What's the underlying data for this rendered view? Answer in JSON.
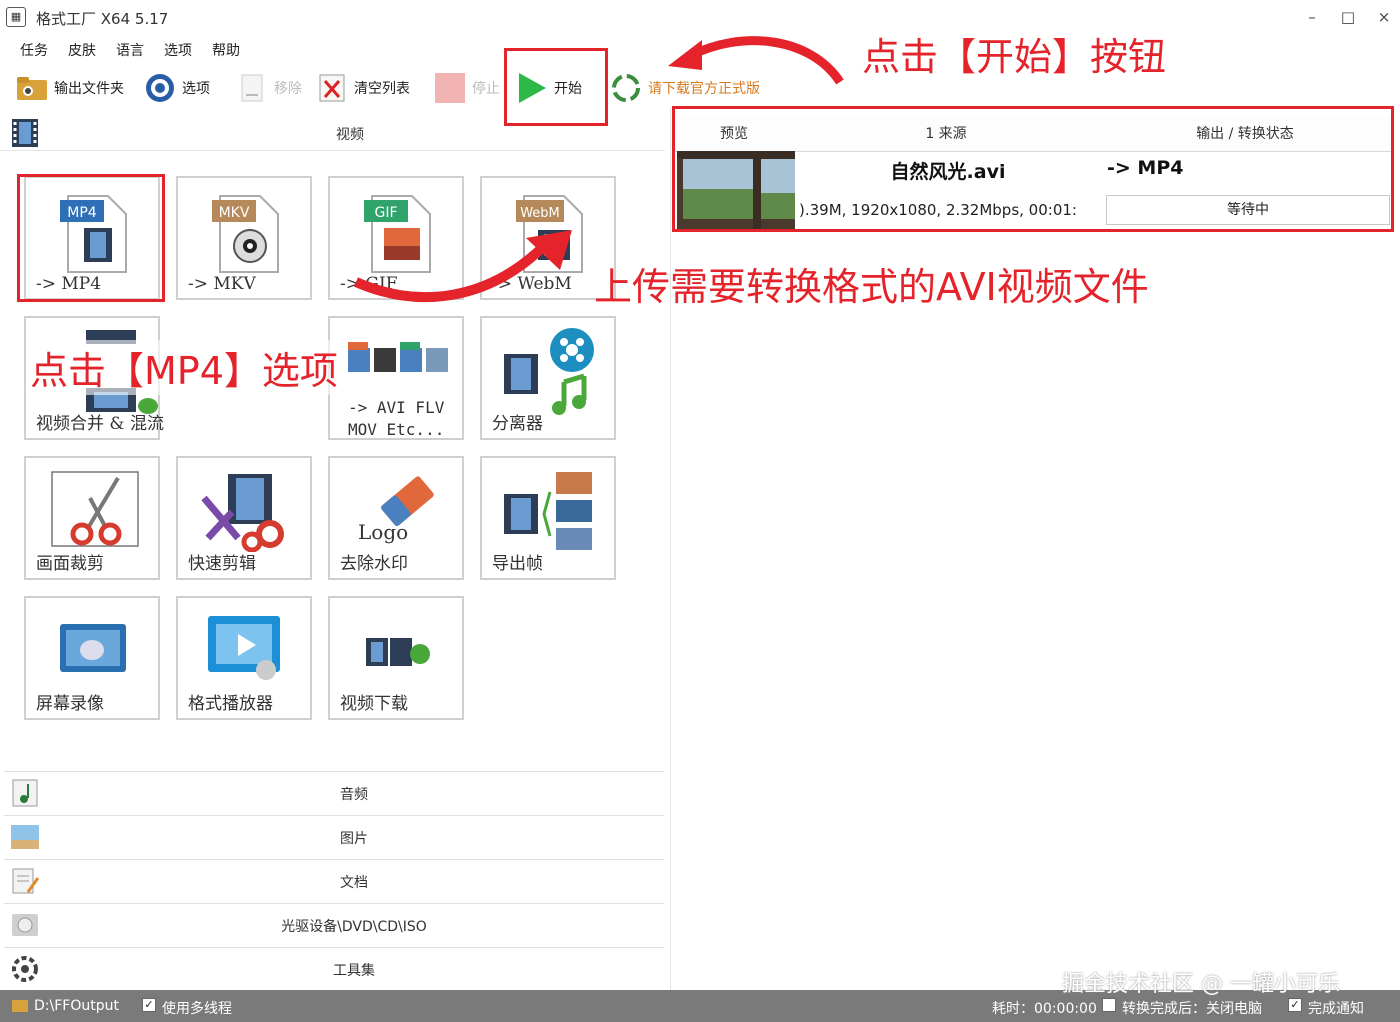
{
  "titlebar": {
    "title": "格式工厂 X64 5.17",
    "minimize": "–",
    "maximize": "□",
    "close": "×"
  },
  "menu": [
    "任务",
    "皮肤",
    "语言",
    "选项",
    "帮助"
  ],
  "toolbar": {
    "output_folder": "输出文件夹",
    "options": "选项",
    "remove": "移除",
    "clear_list": "清空列表",
    "stop": "停止",
    "start": "开始",
    "download_official": "请下载官方正式版"
  },
  "video_section": {
    "title": "视频"
  },
  "tiles": [
    {
      "id": "mp4",
      "badge": "MP4",
      "label": "-> MP4",
      "badge_color": "#2f6fb8"
    },
    {
      "id": "mkv",
      "badge": "MKV",
      "label": "-> MKV",
      "badge_color": "#b5895a"
    },
    {
      "id": "gif",
      "badge": "GIF",
      "label": "-> GIF",
      "badge_color": "#2fa36a"
    },
    {
      "id": "webm",
      "badge": "WebM",
      "label": "-> WebM",
      "badge_color": "#b5895a"
    },
    {
      "id": "merge",
      "label": "视频合并 & 混流"
    },
    {
      "id": "avi",
      "label_line1": "-> AVI FLV",
      "label_line2": "MOV Etc..."
    },
    {
      "id": "splitter",
      "label": "分离器"
    },
    {
      "id": "crop",
      "label": "画面裁剪"
    },
    {
      "id": "quick_cut",
      "label": "快速剪辑"
    },
    {
      "id": "watermark",
      "label": "去除水印",
      "logo_text": "Logo"
    },
    {
      "id": "export_frames",
      "label": "导出帧"
    },
    {
      "id": "screen_record",
      "label": "屏幕录像"
    },
    {
      "id": "player",
      "label": "格式播放器"
    },
    {
      "id": "video_download",
      "label": "视频下载"
    }
  ],
  "categories": [
    "音频",
    "图片",
    "文档",
    "光驱设备\\DVD\\CD\\ISO",
    "工具集"
  ],
  "file_table": {
    "headers": [
      "预览",
      "1 来源",
      "输出 / 转换状态"
    ],
    "rows": [
      {
        "filename": "自然风光.avi",
        "info": ").39M, 1920x1080, 2.32Mbps, 00:01:",
        "output": "-> MP4",
        "status": "等待中"
      }
    ]
  },
  "annotations": {
    "click_start": "点击【开始】按钮",
    "upload_avi": "上传需要转换格式的AVI视频文件",
    "click_mp4": "点击【MP4】选项",
    "color": "#e4232b"
  },
  "statusbar": {
    "output_path": "D:\\FFOutput",
    "multithread": "使用多线程",
    "elapsed": "耗时：00:00:00",
    "after_convert": "转换完成后：关闭电脑",
    "notify": "完成通知"
  },
  "watermark": "掘金技术社区 @ 一罐小可乐"
}
